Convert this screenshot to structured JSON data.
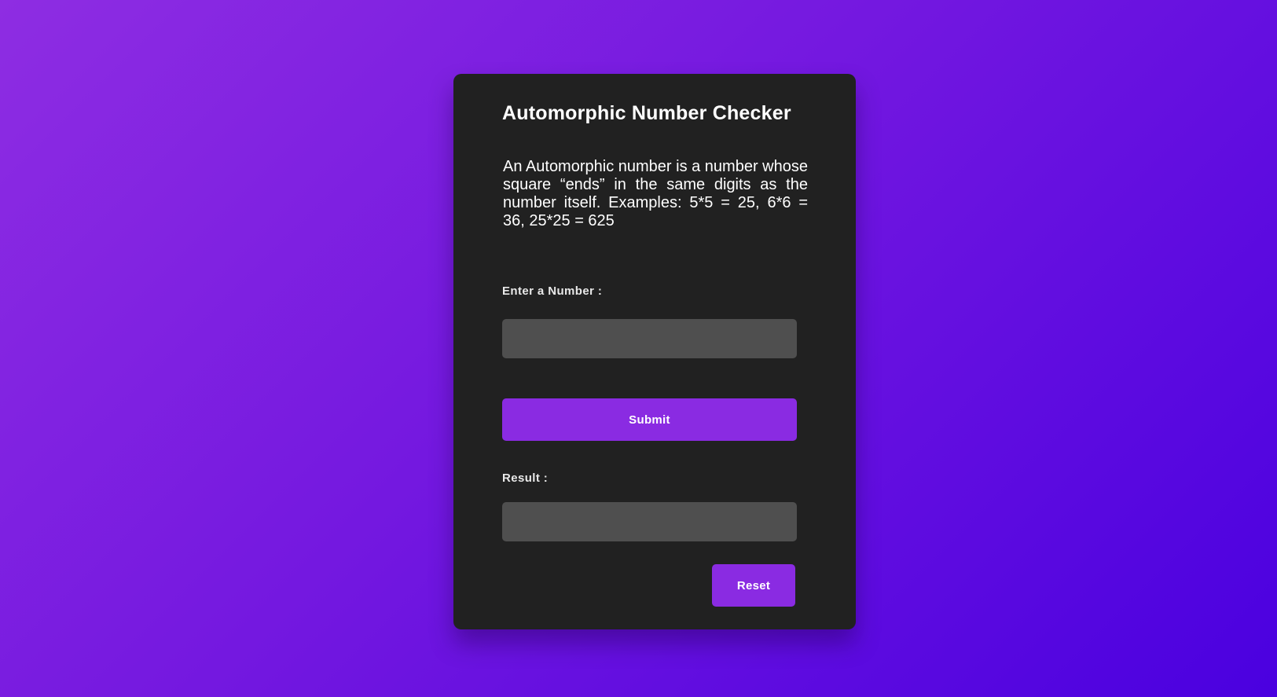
{
  "app": {
    "title": "Automorphic Number Checker",
    "description": "An Automorphic number is a number whose square “ends” in the same digits as the number itself. Examples: 5*5 = 25, 6*6 = 36, 25*25 = 625"
  },
  "form": {
    "number_label": "Enter a Number :",
    "number_value": "",
    "number_placeholder": "",
    "submit_label": "Submit",
    "result_label": "Result :",
    "result_value": "",
    "reset_label": "Reset"
  },
  "colors": {
    "background_start": "#8e2de2",
    "background_end": "#4a00e0",
    "card": "#212121",
    "field": "#4f4f4f",
    "accent": "#8a2be2",
    "text": "#ffffff"
  }
}
